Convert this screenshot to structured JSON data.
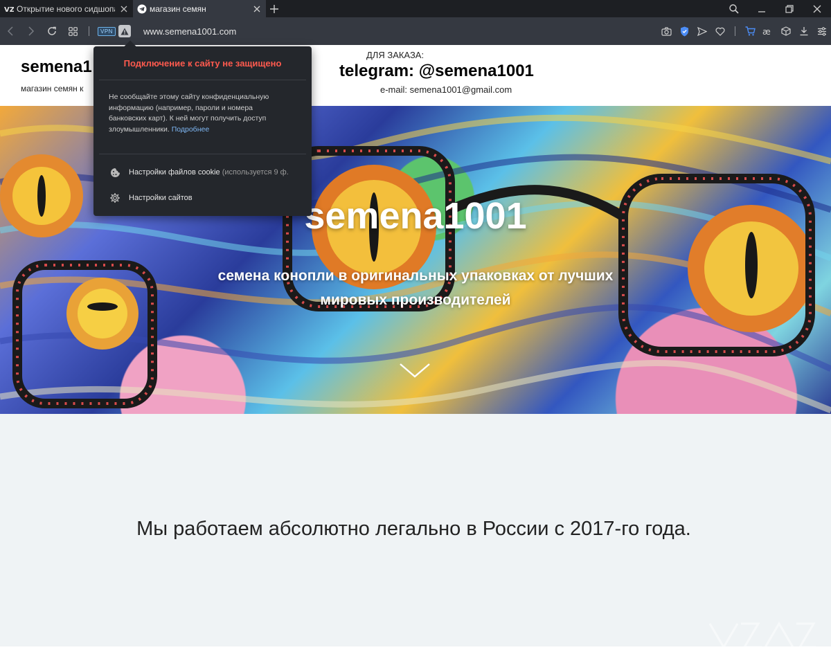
{
  "browser": {
    "tabs": [
      {
        "title": "Открытие нового сидшопа",
        "active": false
      },
      {
        "title": "магазин семян",
        "active": true
      }
    ],
    "address": {
      "vpn_label": "VPN",
      "url": "www.semena1001.com"
    }
  },
  "site": {
    "logo": "semena1",
    "tagline": "магазин семян к",
    "order_label": "ДЛЯ ЗАКАЗА:",
    "telegram": "telegram: @semena1001",
    "email": "e-mail: semena1001@gmail.com"
  },
  "hero": {
    "title": "semena1001",
    "subtitle_line1": "семена конопли в оригинальных упаковках от лучших",
    "subtitle_line2": "мировых производителей"
  },
  "legal": {
    "text": "Мы работаем абсолютно легально в России с 2017-го года."
  },
  "security_popup": {
    "title": "Подключение к сайту не защищено",
    "body_line1": "Не сообщайте этому сайту конфиденциальную",
    "body_line2": "информацию (например, пароли и номера",
    "body_line3": "банковских карт). К ней могут получить доступ",
    "body_line4": "злоумышленники.",
    "more_link": "Подробнее",
    "cookies_label": "Настройки файлов cookie",
    "cookies_note": "(используется 9 ф.",
    "site_settings_label": "Настройки сайтов"
  },
  "colors": {
    "chrome_dark": "#1d1f23",
    "chrome_bar": "#353941",
    "warning_red": "#ff5a4e",
    "link_blue": "#7fb8f5",
    "legal_bg": "#eff3f5"
  }
}
